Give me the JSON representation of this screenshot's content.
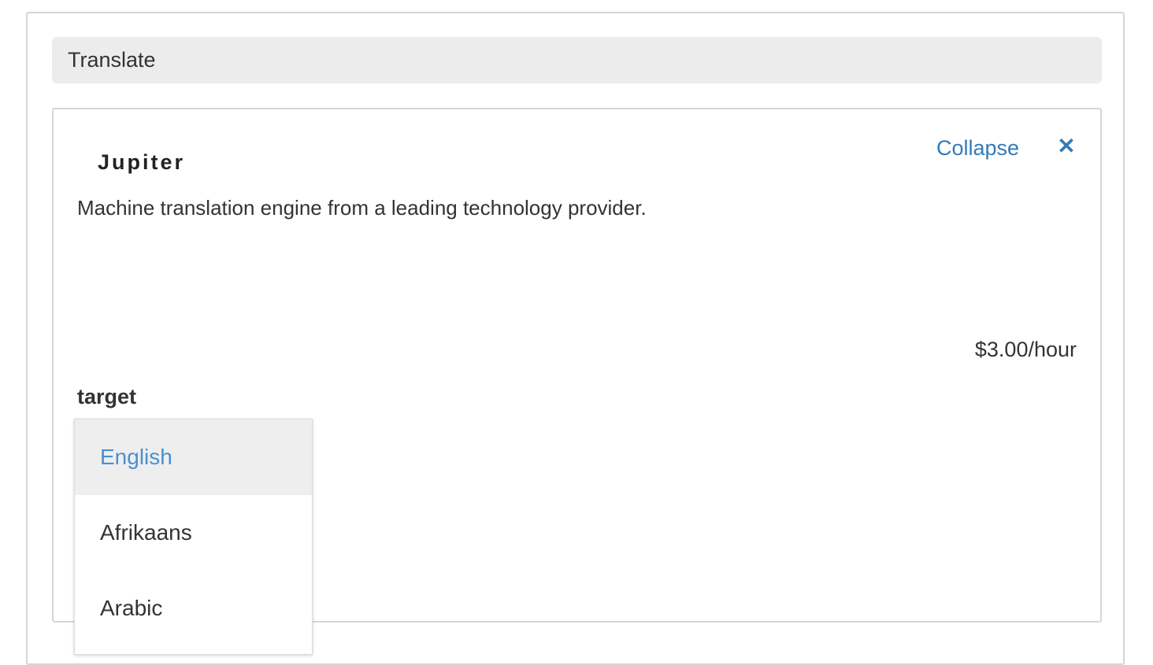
{
  "section": {
    "title": "Translate"
  },
  "engine": {
    "name": "Jupiter",
    "description": "Machine translation engine from a leading technology provider.",
    "collapse_label": "Collapse",
    "close_symbol": "✕",
    "price": "$3.00/hour"
  },
  "target": {
    "label": "target",
    "options": [
      {
        "label": "English",
        "selected": true
      },
      {
        "label": "Afrikaans",
        "selected": false
      },
      {
        "label": "Arabic",
        "selected": false
      }
    ]
  },
  "colors": {
    "link": "#337ab7",
    "selected_option_text": "#4a90d0",
    "selected_option_bg": "#eeeeee",
    "header_bg": "#ececec"
  },
  "icons": {
    "close": "close-icon"
  }
}
